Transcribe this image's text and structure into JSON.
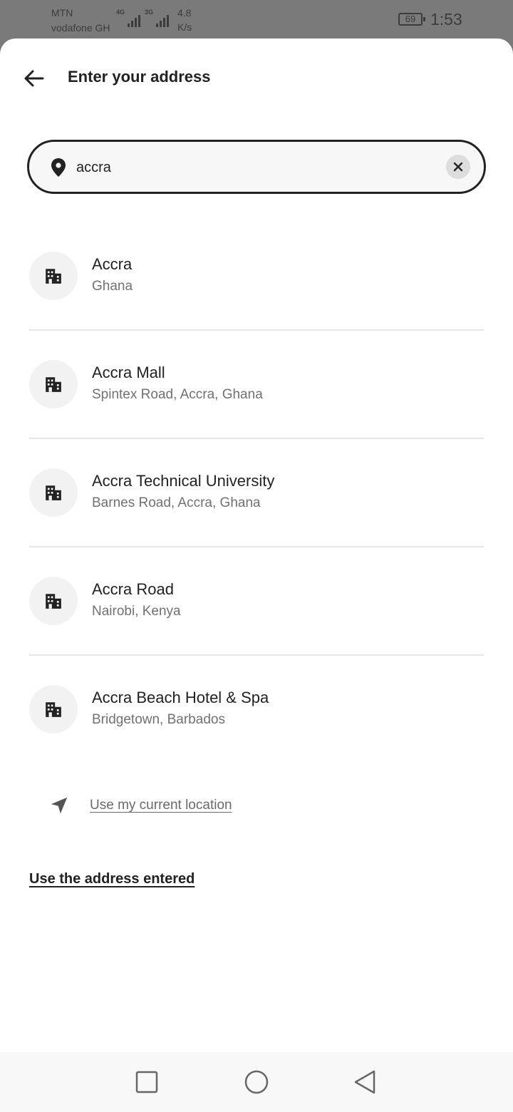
{
  "status_bar": {
    "carrier_1": "MTN",
    "carrier_2": "vodafone GH",
    "net_1": "4G",
    "net_2": "3G",
    "speed_value": "4.8",
    "speed_unit": "K/s",
    "battery": "69",
    "time": "1:53"
  },
  "header": {
    "title": "Enter your address",
    "back_icon": "arrow-left-icon"
  },
  "search": {
    "value": "accra",
    "pin_icon": "location-pin-icon",
    "clear_icon": "close-icon"
  },
  "results": [
    {
      "name": "Accra",
      "detail": "Ghana",
      "icon": "building-icon"
    },
    {
      "name": "Accra Mall",
      "detail": "Spintex Road, Accra, Ghana",
      "icon": "building-icon"
    },
    {
      "name": "Accra Technical University",
      "detail": "Barnes Road, Accra, Ghana",
      "icon": "building-icon"
    },
    {
      "name": "Accra Road",
      "detail": "Nairobi, Kenya",
      "icon": "building-icon"
    },
    {
      "name": "Accra Beach Hotel & Spa",
      "detail": "Bridgetown, Barbados",
      "icon": "building-icon"
    }
  ],
  "current_location": {
    "label": "Use my current location",
    "icon": "navigation-arrow-icon"
  },
  "use_entered": {
    "label": "Use the address entered"
  },
  "nav_bar": {
    "recents_icon": "square-icon",
    "home_icon": "circle-icon",
    "back_icon": "triangle-back-icon"
  },
  "colors": {
    "text": "#222222",
    "muted": "#717171",
    "scrim": "#7a7a7a",
    "icon_bg": "#f2f2f2"
  }
}
